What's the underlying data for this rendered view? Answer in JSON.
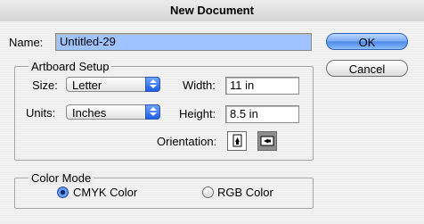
{
  "window": {
    "title": "New Document"
  },
  "name": {
    "label": "Name:",
    "value": "Untitled-29"
  },
  "buttons": {
    "ok": "OK",
    "cancel": "Cancel"
  },
  "artboard": {
    "legend": "Artboard Setup",
    "size": {
      "label": "Size:",
      "value": "Letter"
    },
    "units": {
      "label": "Units:",
      "value": "Inches"
    },
    "width": {
      "label": "Width:",
      "value": "11 in"
    },
    "height": {
      "label": "Height:",
      "value": "8.5 in"
    },
    "orientation": {
      "label": "Orientation:",
      "selected": "landscape",
      "icons": [
        "portrait-orientation-icon",
        "landscape-orientation-icon"
      ]
    }
  },
  "color_mode": {
    "legend": "Color Mode",
    "options": [
      {
        "label": "CMYK Color",
        "selected": true
      },
      {
        "label": "RGB Color",
        "selected": false
      }
    ]
  }
}
